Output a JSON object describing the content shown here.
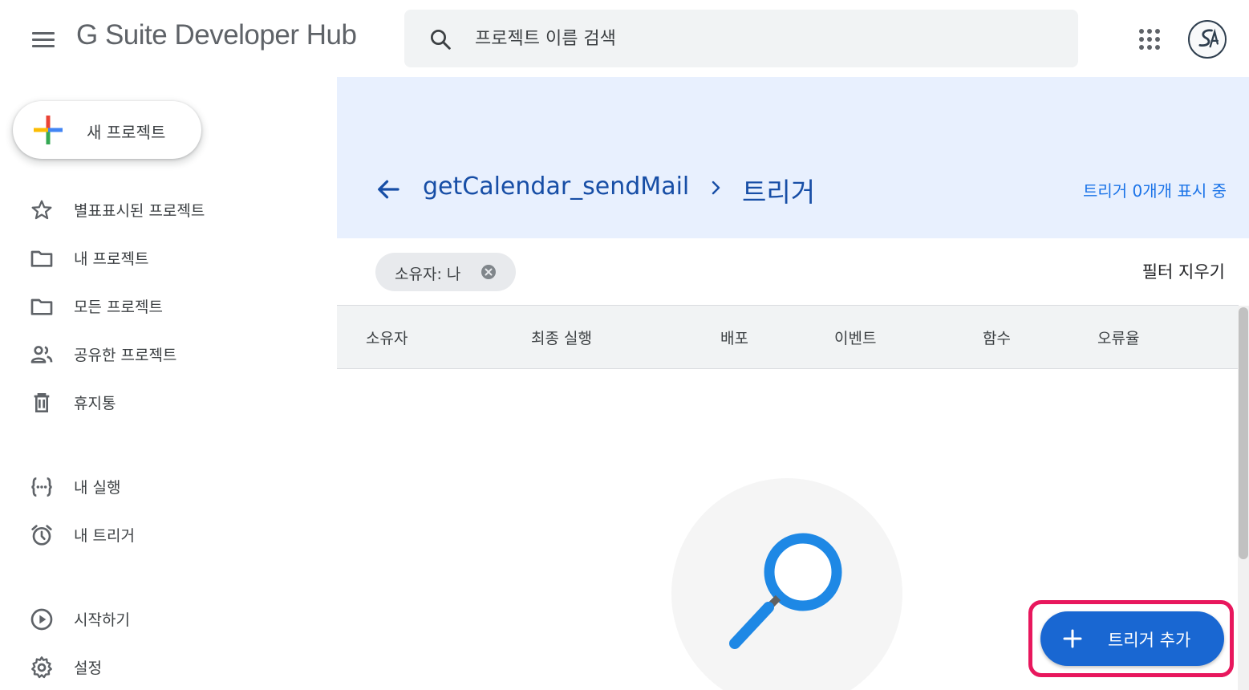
{
  "header": {
    "app_title": "G Suite Developer Hub",
    "search_placeholder": "프로젝트 이름 검색"
  },
  "sidebar": {
    "new_project_label": "새 프로젝트",
    "items": [
      {
        "label": "별표표시된 프로젝트",
        "icon": "star-icon"
      },
      {
        "label": "내 프로젝트",
        "icon": "folder-icon"
      },
      {
        "label": "모든 프로젝트",
        "icon": "folder-icon"
      },
      {
        "label": "공유한 프로젝트",
        "icon": "people-icon"
      },
      {
        "label": "휴지통",
        "icon": "trash-icon"
      },
      {
        "label": "내 실행",
        "icon": "executions-icon"
      },
      {
        "label": "내 트리거",
        "icon": "alarm-icon"
      },
      {
        "label": "시작하기",
        "icon": "play-circle-icon"
      },
      {
        "label": "설정",
        "icon": "gear-icon"
      }
    ]
  },
  "main": {
    "breadcrumb": {
      "project": "getCalendar_sendMail",
      "page": "트리거"
    },
    "count_text": "트리거 0개개 표시 중",
    "filter_chip": "소유자: 나",
    "clear_filters": "필터 지우기",
    "columns": [
      "소유자",
      "최종 실행",
      "배포",
      "이벤트",
      "함수",
      "오류율"
    ],
    "fab_label": "트리거 추가"
  },
  "colors": {
    "accent": "#1a73e8",
    "banner": "#e8f0fe",
    "fab": "#1967d2",
    "highlight": "#e8175d"
  }
}
